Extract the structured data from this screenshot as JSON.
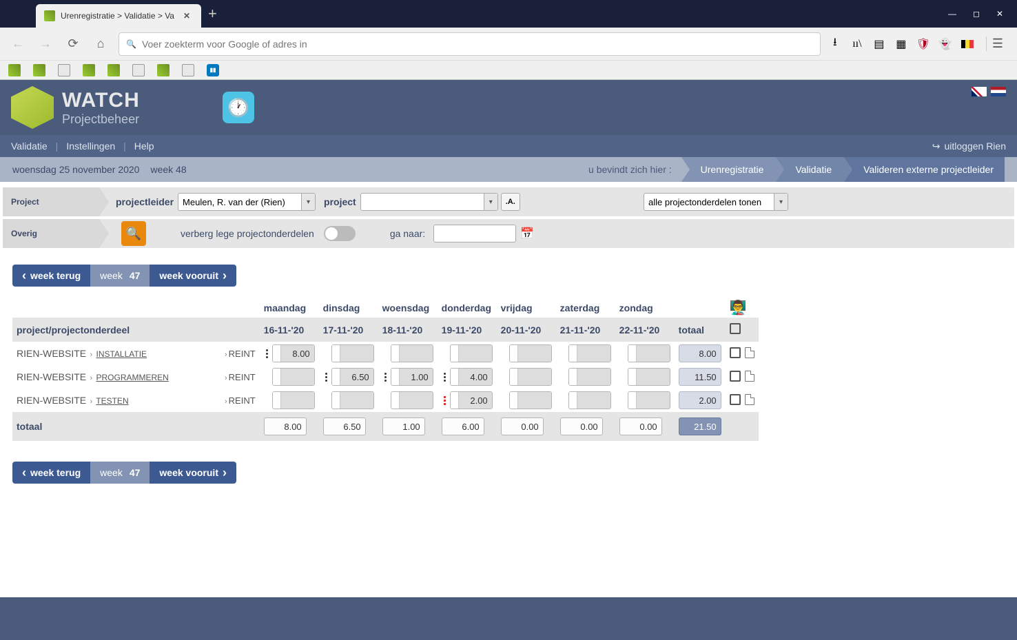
{
  "browser": {
    "tab_title": "Urenregistratie > Validatie > Va",
    "url_placeholder": "Voer zoekterm voor Google of adres in"
  },
  "brand": {
    "title": "WATCH",
    "subtitle": "Projectbeheer"
  },
  "menu": {
    "validatie": "Validatie",
    "instellingen": "Instellingen",
    "help": "Help",
    "logout": "uitloggen Rien"
  },
  "date_bar": {
    "date": "woensdag 25 november 2020",
    "week": "week 48",
    "here_label": "u bevindt zich hier :",
    "crumb1": "Urenregistratie",
    "crumb2": "Validatie",
    "crumb3": "Valideren externe projectleider"
  },
  "filters": {
    "project_tag": "Project",
    "overig_tag": "Overig",
    "projectleider_label": "projectleider",
    "projectleider_value": "Meulen, R. van der (Rien)",
    "project_label": "project",
    "project_value": "",
    "aa_btn": ".A.",
    "tonen_value": "alle projectonderdelen tonen",
    "verberg_label": "verberg lege projectonderdelen",
    "ganaar_label": "ga naar:"
  },
  "weeknav": {
    "back": "week terug",
    "label_week": "week",
    "label_num": "47",
    "fwd": "week vooruit"
  },
  "table": {
    "days": {
      "ma": "maandag",
      "di": "dinsdag",
      "wo": "woensdag",
      "do": "donderdag",
      "vr": "vrijdag",
      "za": "zaterdag",
      "zo": "zondag"
    },
    "dates": {
      "ma": "16-11-'20",
      "di": "17-11-'20",
      "wo": "18-11-'20",
      "do": "19-11-'20",
      "vr": "20-11-'20",
      "za": "21-11-'20",
      "zo": "22-11-'20"
    },
    "header_proj": "project/projectonderdeel",
    "header_total": "totaal",
    "rows": [
      {
        "project": "RIEN-WEBSITE",
        "part": "INSTALLATIE",
        "user": "REINT",
        "cells": {
          "ma": "8.00",
          "di": "",
          "wo": "",
          "do": "",
          "vr": "",
          "za": "",
          "zo": ""
        },
        "total": "8.00"
      },
      {
        "project": "RIEN-WEBSITE",
        "part": "PROGRAMMEREN",
        "user": "REINT",
        "cells": {
          "ma": "",
          "di": "6.50",
          "wo": "1.00",
          "do": "4.00",
          "vr": "",
          "za": "",
          "zo": ""
        },
        "total": "11.50"
      },
      {
        "project": "RIEN-WEBSITE",
        "part": "TESTEN",
        "user": "REINT",
        "cells": {
          "ma": "",
          "di": "",
          "wo": "",
          "do": "2.00",
          "vr": "",
          "za": "",
          "zo": ""
        },
        "total": "2.00"
      }
    ],
    "totals": {
      "label": "totaal",
      "ma": "8.00",
      "di": "6.50",
      "wo": "1.00",
      "do": "6.00",
      "vr": "0.00",
      "za": "0.00",
      "zo": "0.00",
      "grand": "21.50"
    }
  }
}
